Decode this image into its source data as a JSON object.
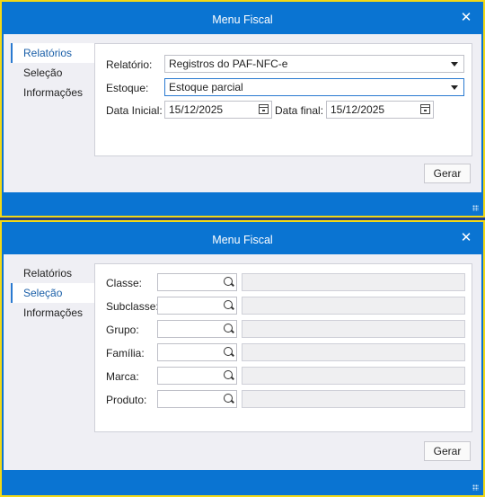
{
  "windows": [
    {
      "title": "Menu Fiscal",
      "close_icon": "close-icon",
      "tabs": [
        "Relatórios",
        "Seleção",
        "Informações"
      ],
      "active_tab": "Relatórios",
      "form": {
        "relatorio_label": "Relatório:",
        "relatorio_value": "Registros do PAF-NFC-e",
        "estoque_label": "Estoque:",
        "estoque_value": "Estoque parcial",
        "data_inicial_label": "Data Inicial:",
        "data_inicial_value": "15/12/2025",
        "data_final_label": "Data final:",
        "data_final_value": "15/12/2025"
      },
      "button": "Gerar"
    },
    {
      "title": "Menu Fiscal",
      "close_icon": "close-icon",
      "tabs": [
        "Relatórios",
        "Seleção",
        "Informações"
      ],
      "active_tab": "Seleção",
      "fields": [
        {
          "label": "Classe:",
          "value": "",
          "description": ""
        },
        {
          "label": "Subclasse:",
          "value": "",
          "description": ""
        },
        {
          "label": "Grupo:",
          "value": "",
          "description": ""
        },
        {
          "label": "Família:",
          "value": "",
          "description": ""
        },
        {
          "label": "Marca:",
          "value": "",
          "description": ""
        },
        {
          "label": "Produto:",
          "value": "",
          "description": ""
        }
      ],
      "button": "Gerar"
    }
  ],
  "colors": {
    "accent": "#0a74d2",
    "border_highlight": "#f2d816",
    "active_tab_text": "#1a5fa8"
  }
}
